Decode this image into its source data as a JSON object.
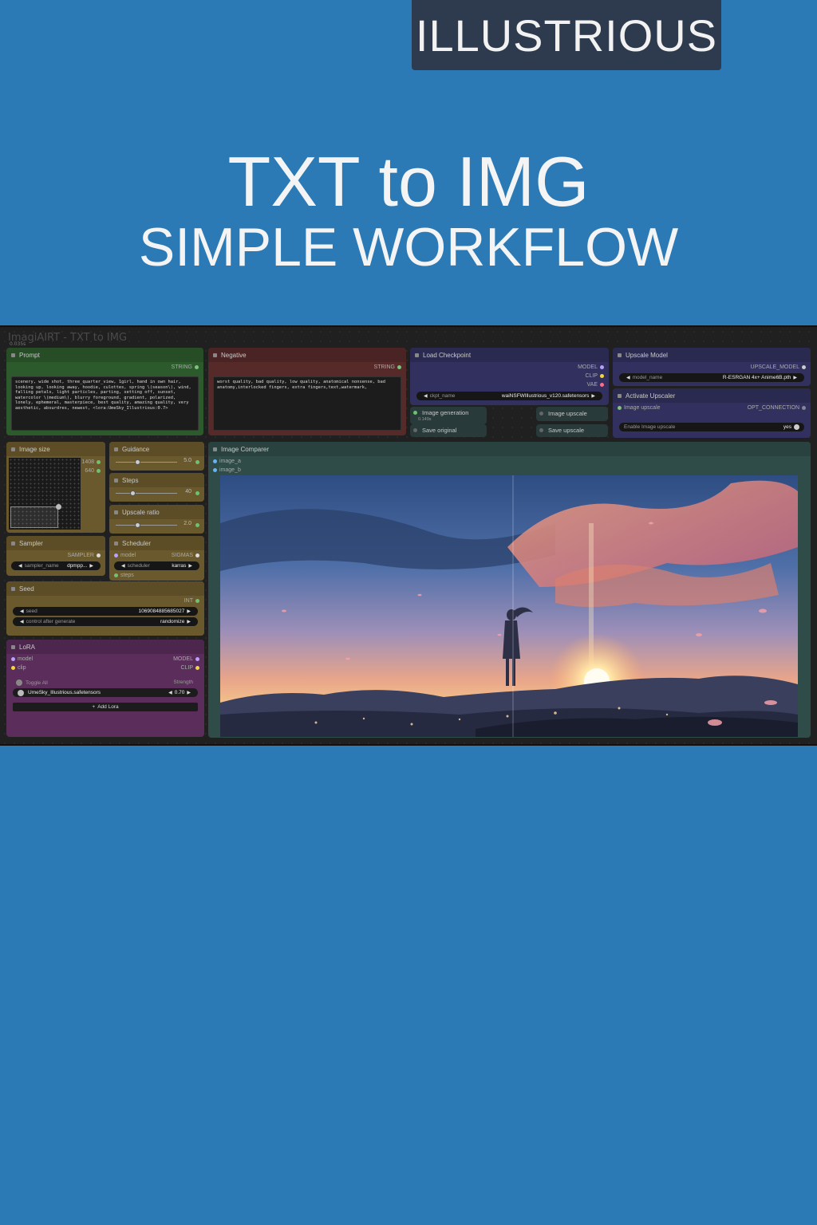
{
  "banner": {
    "badge": "ILLUSTRIOUS",
    "title_line1": "TXT to IMG",
    "title_line2": "SIMPLE WORKFLOW"
  },
  "workflow": {
    "name": "ImagiAIRT - TXT to IMG",
    "time": "0.035s"
  },
  "prompt_node": {
    "title": "Prompt",
    "output": "STRING",
    "text": "scenery, wide shot, three_quarter_view, 1girl, hand in own hair, looking up, looking away, hoodie, culottes, spring \\(season\\), wind, falling petals, light particles, parting, setting off, sunset, watercolor \\(medium\\), blurry foreground, gradient, polarized, lonely, ephemeral, masterpiece, best quality, amazing quality, very aesthetic, absurdres, newest, <lora:UmeSky_Illustrious:0.7>"
  },
  "negative_node": {
    "title": "Negative",
    "output": "STRING",
    "text": "worst quality, bad quality, low quality, anatomical nonsense, bad anatomy,interlocked fingers, extra fingers,text,watermark,"
  },
  "checkpoint_node": {
    "title": "Load Checkpoint",
    "outputs": [
      "MODEL",
      "CLIP",
      "VAE"
    ],
    "ckpt_label": "ckpt_name",
    "ckpt_value": "waiNSFWIllustrious_v120.safetensors"
  },
  "groups": {
    "image_generation": "Image generation",
    "image_generation_time": "0.149s",
    "save_original": "Save original",
    "image_upscale": "Image upscale",
    "save_upscale": "Save upscale"
  },
  "upscale_model_node": {
    "title": "Upscale Model",
    "output": "UPSCALE_MODEL",
    "model_label": "model_name",
    "model_value": "R-ESRGAN 4x+ Anime6B.pth"
  },
  "activate_upscaler_node": {
    "title": "Activate Upscaler",
    "input": "Image upscale",
    "output": "OPT_CONNECTION",
    "toggle_label": "Enable Image upscale",
    "toggle_value": "yes"
  },
  "image_size_node": {
    "title": "Image size",
    "width": "1408",
    "height": "640"
  },
  "guidance_node": {
    "title": "Guidance",
    "value": "5.0",
    "fraction": 0.35
  },
  "steps_node": {
    "title": "Steps",
    "value": "40",
    "fraction": 0.27
  },
  "upscale_ratio_node": {
    "title": "Upscale ratio",
    "value": "2.0",
    "fraction": 0.35
  },
  "sampler_node": {
    "title": "Sampler",
    "output": "SAMPLER",
    "label": "sampler_name",
    "value": "dpmpp..."
  },
  "scheduler_node": {
    "title": "Scheduler",
    "input_model": "model",
    "input_steps": "steps",
    "output": "SIGMAS",
    "label": "scheduler",
    "value": "karras"
  },
  "seed_node": {
    "title": "Seed",
    "output": "INT",
    "seed_label": "seed",
    "seed_value": "1069084885685027",
    "control_label": "control after generate",
    "control_value": "randomize"
  },
  "lora_node": {
    "title": "LoRA",
    "inputs": [
      "model",
      "clip"
    ],
    "outputs": [
      "MODEL",
      "CLIP"
    ],
    "toggle_all": "Toggle All",
    "strength_label": "Strength",
    "lora_name": "UmeSky_Illustrious.safetensors",
    "lora_strength": "0.70",
    "add_button": "Add Lora"
  },
  "comparer_node": {
    "title": "Image Comparer",
    "inputs": [
      "image_a",
      "image_b"
    ]
  },
  "colors": {
    "background": "#2b7ab6",
    "badge": "#2e3a4d",
    "prompt_green": "#2f5e2f",
    "negative_red": "#5a2a2a",
    "checkpoint_blue": "#303060",
    "size_brown": "#6b5a2c",
    "lora_purple": "#5a2e5a",
    "comparer_teal": "#2f4f4a"
  }
}
